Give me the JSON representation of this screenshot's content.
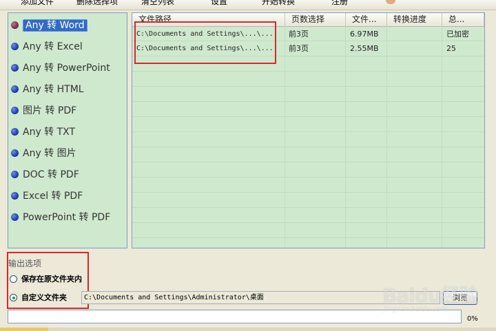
{
  "toolbar": {
    "buttons": [
      "添加文件",
      "删除选择项",
      "清空列表",
      "设置",
      "开始转换",
      "注册"
    ]
  },
  "converters": [
    {
      "label": "Any 转 Word",
      "selected": true
    },
    {
      "label": "Any 转 Excel",
      "selected": false
    },
    {
      "label": "Any 转 PowerPoint",
      "selected": false
    },
    {
      "label": "Any 转 HTML",
      "selected": false
    },
    {
      "label": "图片 转 PDF",
      "selected": false
    },
    {
      "label": "Any 转 TXT",
      "selected": false
    },
    {
      "label": "Any 转 图片",
      "selected": false
    },
    {
      "label": "DOC 转 PDF",
      "selected": false
    },
    {
      "label": "Excel 转 PDF",
      "selected": false
    },
    {
      "label": "PowerPoint 转 PDF",
      "selected": false
    }
  ],
  "file_table": {
    "columns": [
      "文件路径",
      "页数选择",
      "文件...",
      "转换进度",
      "总..."
    ],
    "rows": [
      {
        "path": "C:\\Documents and Settings\\...\\...",
        "pages": "前3页",
        "size": "6.97MB",
        "progress": "",
        "total": "已加密"
      },
      {
        "path": "C:\\Documents and Settings\\...\\...",
        "pages": "前3页",
        "size": "2.55MB",
        "progress": "",
        "total": "25"
      }
    ]
  },
  "output": {
    "title": "输出选项",
    "option_original": "保存在原文件夹内",
    "option_custom": "自定义文件夹",
    "selected": "custom",
    "custom_path": "C:\\Documents and Settings\\Administrator\\桌面",
    "browse_label": "浏览"
  },
  "progress": {
    "value": 0,
    "text": "0%"
  },
  "watermark": {
    "main": "Baidu经验",
    "sub": "jingyan.baidu.com"
  },
  "colors": {
    "panel_bg": "#cfe9cf",
    "selection": "#316ac5",
    "highlight_box": "#d9262b"
  }
}
